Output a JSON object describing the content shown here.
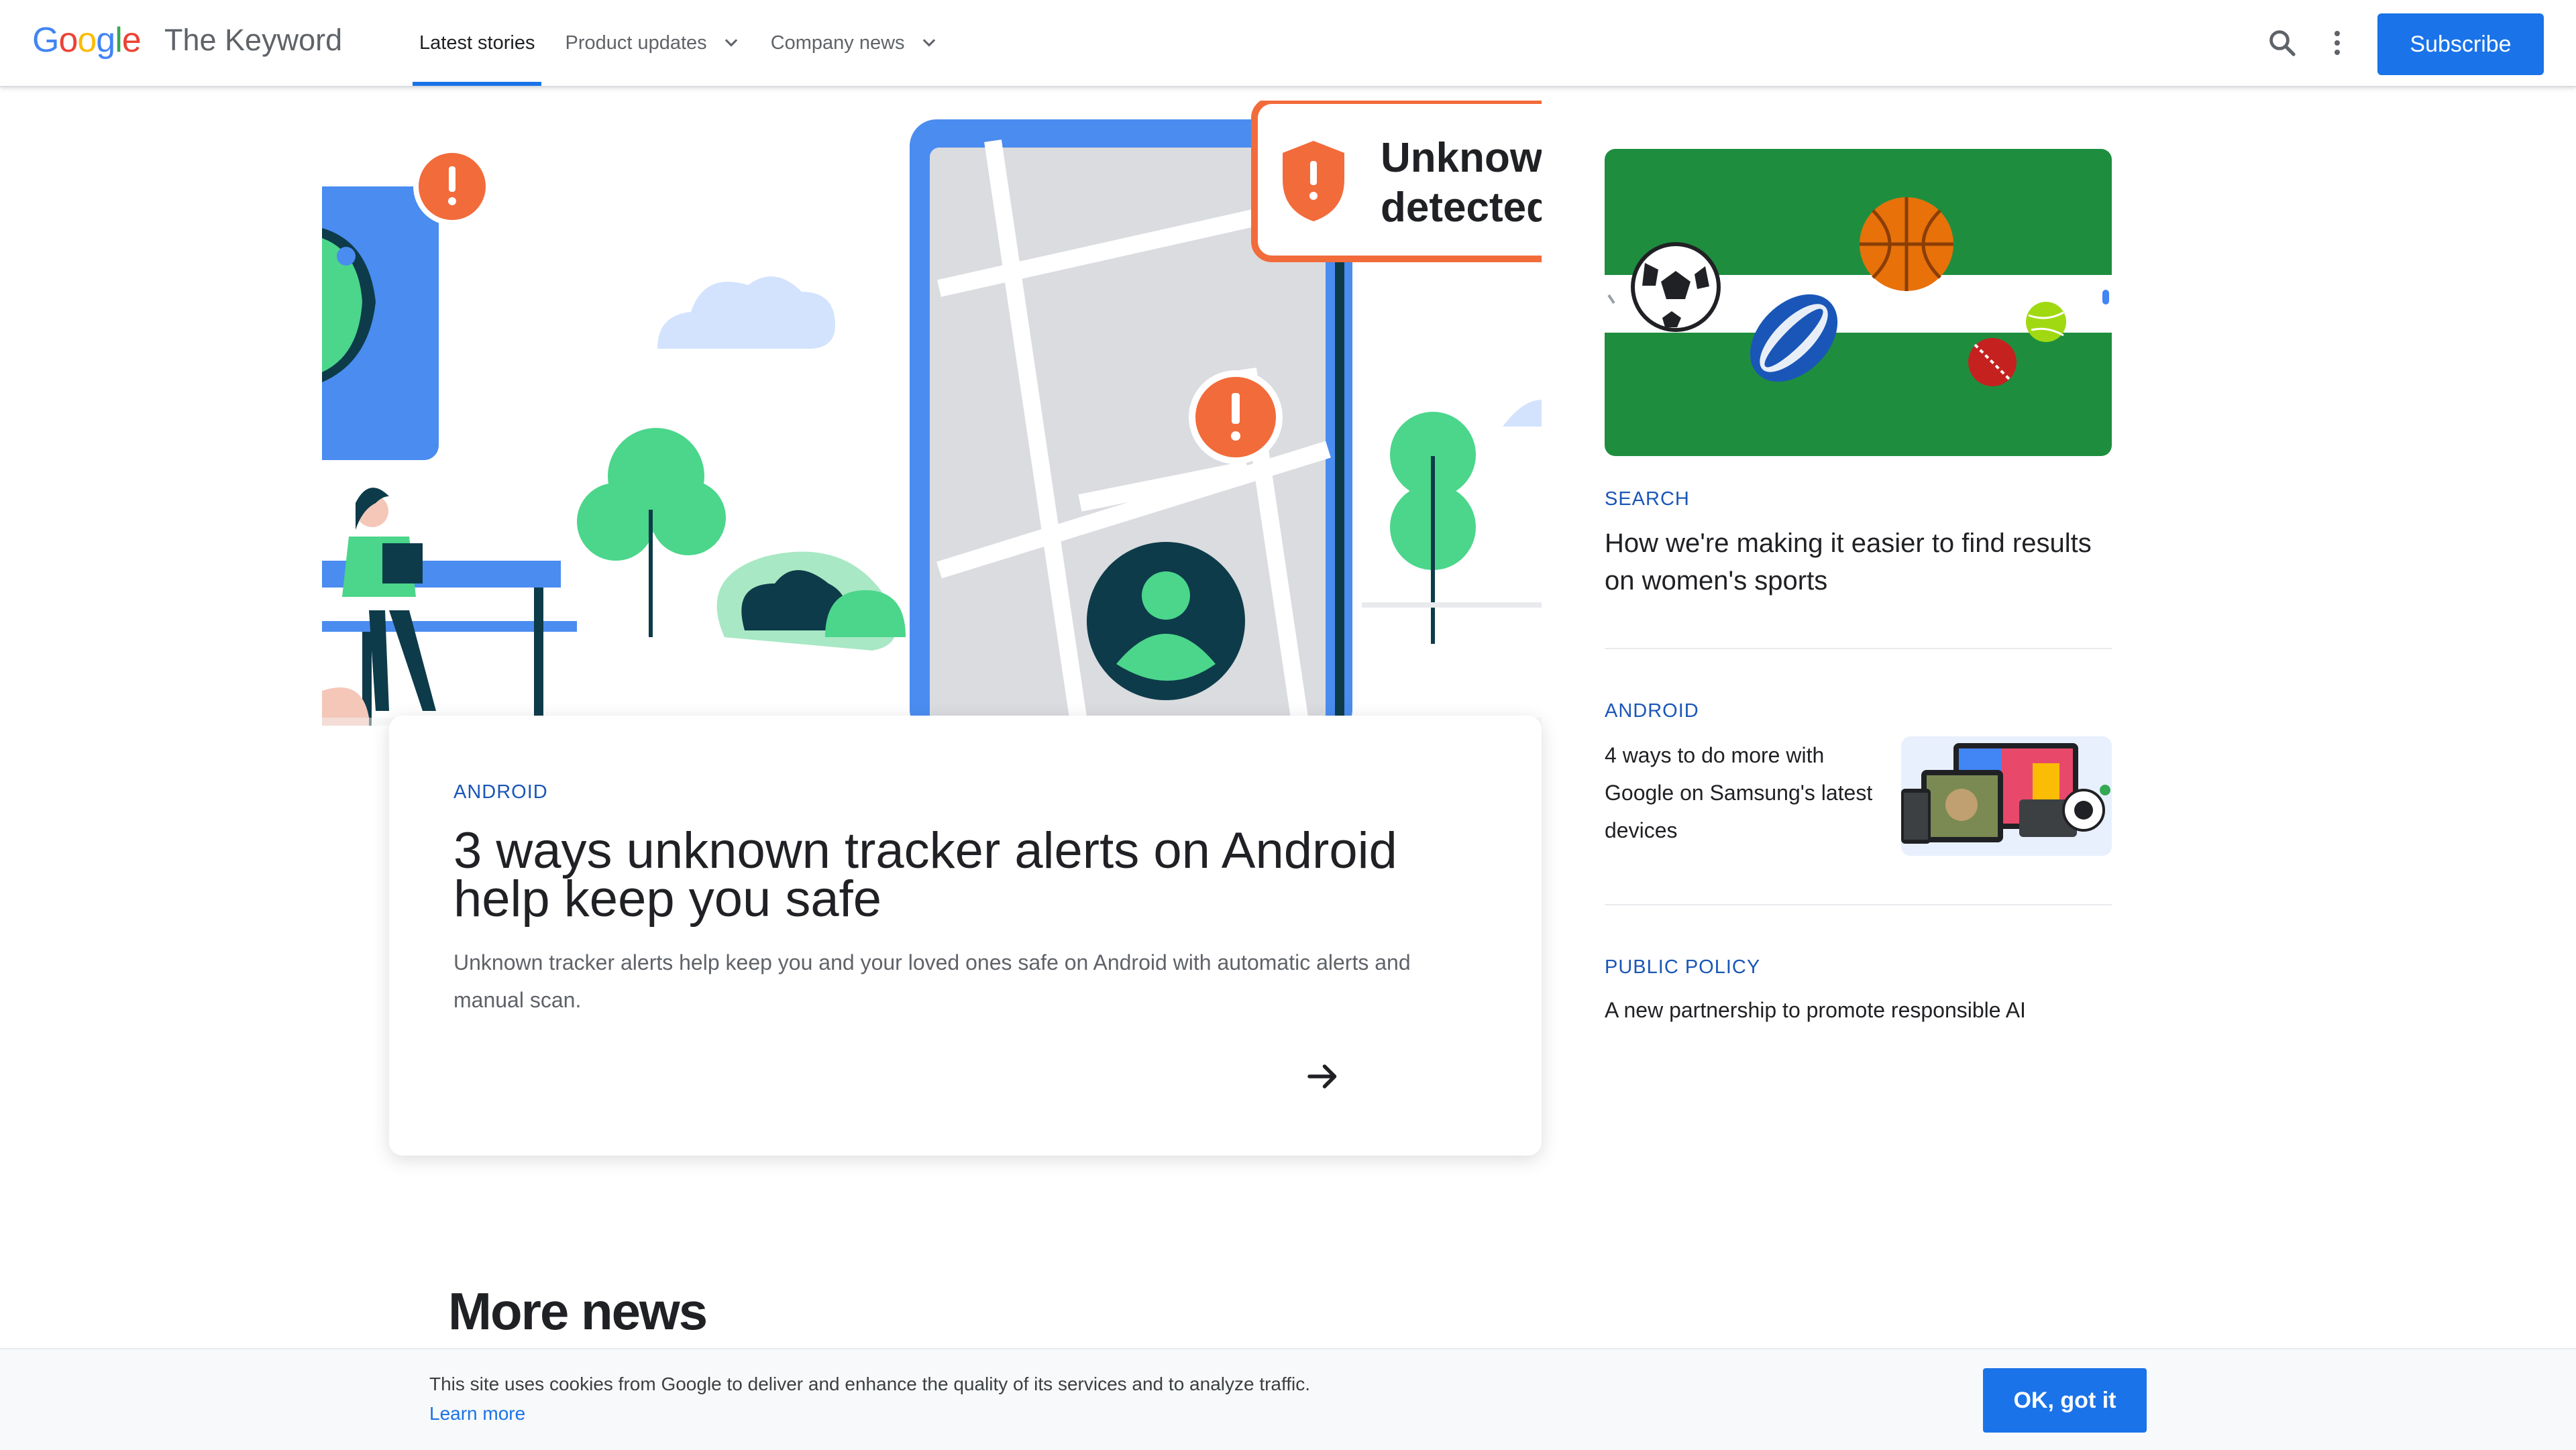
{
  "header": {
    "logo_letters": [
      "G",
      "o",
      "o",
      "g",
      "l",
      "e"
    ],
    "logo_colors": [
      "#4285F4",
      "#EA4335",
      "#FBBC05",
      "#4285F4",
      "#34A853",
      "#EA4335"
    ],
    "site_title": "The Keyword",
    "nav": [
      {
        "label": "Latest stories",
        "active": true
      },
      {
        "label": "Product updates",
        "dropdown": true
      },
      {
        "label": "Company news",
        "dropdown": true
      }
    ],
    "search_icon": "search-icon",
    "more_icon": "more-vert-icon",
    "subscribe_label": "Subscribe"
  },
  "hero": {
    "image_text_line1": "Unknown",
    "image_text_line2": "detected",
    "category": "ANDROID",
    "title": "3 ways unknown tracker alerts on Android help keep you safe",
    "description": "Unknown tracker alerts help keep you and your loved ones safe on Android with automatic alerts and manual scan.",
    "arrow_icon": "arrow-forward-icon"
  },
  "sidebar": {
    "items": [
      {
        "category": "SEARCH",
        "title": "How we're making it easier to find results on women's sports"
      },
      {
        "category": "ANDROID",
        "title": "4 ways to do more with Google on Samsung's latest devices"
      },
      {
        "category": "PUBLIC POLICY",
        "title": "A new partnership to promote responsible AI"
      }
    ]
  },
  "more_news": {
    "heading": "More news"
  },
  "cookie": {
    "text": "This site uses cookies from Google to deliver and enhance the quality of its services and to analyze traffic.",
    "learn_more": "Learn more",
    "ok_label": "OK, got it"
  },
  "colors": {
    "accent": "#1a73e8",
    "eyebrow": "#1a56b8",
    "alert": "#f26b3a",
    "tree": "#4bd68b",
    "field": "#1e8e3e"
  }
}
